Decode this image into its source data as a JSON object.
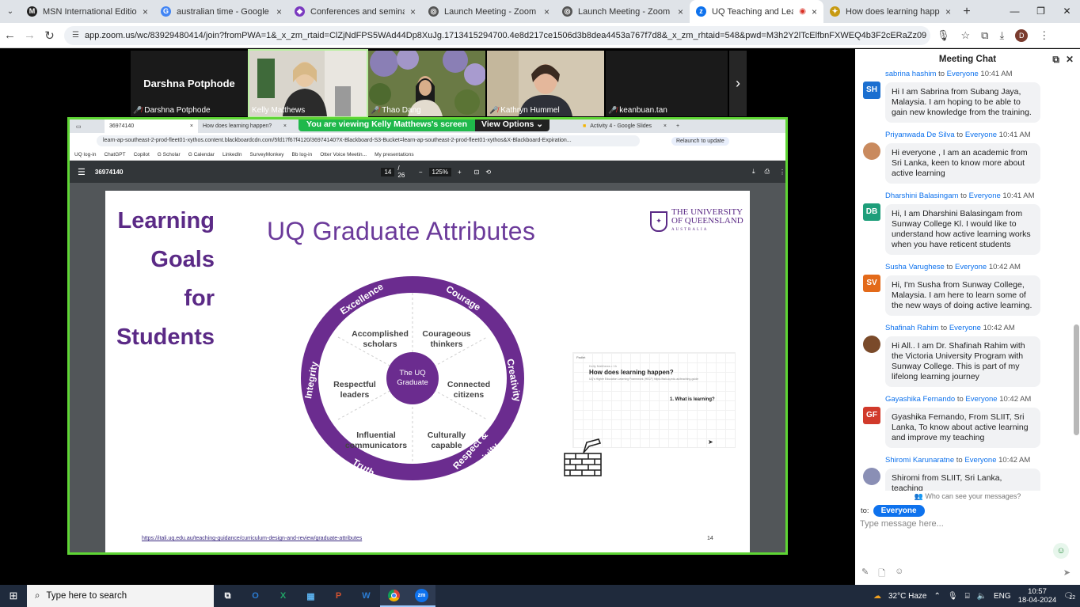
{
  "browser": {
    "tabs": [
      {
        "title": "MSN International Edition - W",
        "icon": "msn-icon",
        "color": "#222"
      },
      {
        "title": "australian time - Google Searc",
        "icon": "google-icon",
        "color": "#4285f4"
      },
      {
        "title": "Conferences and seminars - Gi",
        "icon": "shield-icon",
        "color": "#7b3ac0"
      },
      {
        "title": "Launch Meeting - Zoom",
        "icon": "globe-icon",
        "color": "#555"
      },
      {
        "title": "Launch Meeting - Zoom",
        "icon": "globe-icon",
        "color": "#555"
      },
      {
        "title": "UQ Teaching and Learning",
        "icon": "zoom-icon",
        "color": "#0e72ed",
        "active": true
      },
      {
        "title": "How does learning happen?",
        "icon": "padlet-icon",
        "color": "#c79a12"
      }
    ],
    "url": "app.zoom.us/wc/83929480414/join?fromPWA=1&_x_zm_rtaid=ClZjNdFPS5WAd44Dp8XuJg.1713415294700.4e8d217ce1506d3b8dea4453a767f7d8&_x_zm_rhtaid=548&pwd=M3h2Y2lTcElfbnFXWEQ4b3F2cERaZz09",
    "profile_initial": "D"
  },
  "gallery": {
    "participants": [
      {
        "name": "Darshna Potphode",
        "display": "Darshna Potphode",
        "video": false,
        "muted": true
      },
      {
        "name": "Kelly Matthews",
        "video": true,
        "muted": false,
        "active": true
      },
      {
        "name": "Thao Dang",
        "video": true,
        "muted": true
      },
      {
        "name": "Kathryn Hummel",
        "video": true,
        "muted": true
      },
      {
        "name": "keanbuan.tan",
        "video": false,
        "muted": true
      }
    ]
  },
  "share": {
    "viewing_label": "You are viewing  Kelly Matthews's screen",
    "view_options": "View Options",
    "tabs": [
      {
        "title": "36974140",
        "active": true
      },
      {
        "title": "How does learning happen?"
      },
      {
        "title": "Activity 4 - Google Slides"
      }
    ],
    "url": "learn-ap-southeast-2-prod-fleet01-xythos.content.blackboardcdn.com/5fd17f67f4120/36974140?X-Blackboard-S3-Bucket=learn-ap-southeast-2-prod-fleet01-xythos&X-Blackboard-Expiration...",
    "relaunch": "Relaunch to update",
    "bookmarks": [
      "UQ log-in",
      "ChatGPT",
      "Copilot",
      "G Scholar",
      "G Calendar",
      "LinkedIn",
      "SurveyMonkey",
      "Bb log-in",
      "Otter Voice Meetin...",
      "My presentations"
    ],
    "pdf": {
      "name": "36974140",
      "page": "14",
      "total": "/ 26",
      "zoom": "125%"
    },
    "slide": {
      "learning_goals": [
        "Learning",
        "Goals",
        "for",
        "Students"
      ],
      "title": "UQ Graduate Attributes",
      "logo_line1": "THE UNIVERSITY",
      "logo_line2": "OF QUEENSLAND",
      "logo_line3": "AUSTRALIA",
      "center": [
        "The UQ",
        "Graduate"
      ],
      "segments": [
        [
          "Accomplished",
          "scholars"
        ],
        [
          "Courageous",
          "thinkers"
        ],
        [
          "Connected",
          "citizens"
        ],
        [
          "Culturally",
          "capable"
        ],
        [
          "Influential",
          "communicators"
        ],
        [
          "Respectful",
          "leaders"
        ]
      ],
      "ring_words": [
        "Excellence",
        "Courage",
        "Creativity",
        "Respect &",
        "Inclusivity",
        "Truth",
        "Integrity"
      ],
      "thumb_title": "How does learning happen?",
      "thumb_sub": "UQ's Higher Education Learning Framework (HELF) https://itali.uq.edu.au/teaching-guide",
      "thumb_brand": "Padlet",
      "thumb_author": "Kelly Matthews • 1h",
      "thumb_q": "1. What is learning?",
      "link": "https://itali.uq.edu.au/teaching-guidance/curriculum-design-and-review/graduate-attributes",
      "page_num": "14"
    }
  },
  "chat": {
    "title": "Meeting Chat",
    "messages": [
      {
        "name": "sabrina hashim",
        "to": "to",
        "target": "Everyone",
        "time": "10:41 AM",
        "avatar": "SH",
        "color": "#1b6fd0",
        "text": "Hi I am Sabrina from Subang Jaya, Malaysia. I am hoping to be able to gain new knowledge from the training."
      },
      {
        "name": "Priyanwada De Silva",
        "to": "to",
        "target": "Everyone",
        "time": "10:41 AM",
        "avatar": "",
        "color": "#c98a5e",
        "photo": true,
        "text": "Hi everyone , I am an academic from Sri Lanka, keen to know more about active learning"
      },
      {
        "name": "Dharshini Balasingam",
        "to": "to",
        "target": "Everyone",
        "time": "10:41 AM",
        "avatar": "DB",
        "color": "#1e9e7a",
        "text": "Hi, I am Dharshini Balasingam from Sunway College Kl. I  would like to understand how active learning works when you have reticent students"
      },
      {
        "name": "Susha Varughese",
        "to": "to",
        "target": "Everyone",
        "time": "10:42 AM",
        "avatar": "SV",
        "color": "#e36a1a",
        "text": "Hi, I'm Susha from Sunway College, Malaysia. I am here to learn some of the new ways of doing active learning."
      },
      {
        "name": "Shafinah Rahim",
        "to": "to",
        "target": "Everyone",
        "time": "10:42 AM",
        "avatar": "",
        "color": "#7a4a2a",
        "photo": true,
        "text": "Hi All.. I am Dr. Shafinah Rahim with the Victoria University Program with Sunway College.  This is part of my lifelong learning journey"
      },
      {
        "name": "Gayashika Fernando",
        "to": "to",
        "target": "Everyone",
        "time": "10:42 AM",
        "avatar": "GF",
        "color": "#d13a2b",
        "text": "Gyashika Fernando, From SLIIT, Sri Lanka, To know about active learning and improve my teaching"
      },
      {
        "name": "Shiromi Karunaratne",
        "to": "to",
        "target": "Everyone",
        "time": "10:42 AM",
        "avatar": "",
        "color": "#8a8fb5",
        "photo": true,
        "text": "Shiromi from SLIIT, Sri Lanka, teaching"
      }
    ],
    "who_can_see": "Who can see your messages?",
    "to_label": "to:",
    "recipient": "Everyone",
    "placeholder": "Type message here..."
  },
  "taskbar": {
    "search_placeholder": "Type here to search",
    "apps": [
      "task-view",
      "outlook",
      "excel",
      "calculator",
      "powerpoint",
      "word",
      "chrome",
      "zoom"
    ],
    "app_labels": [
      "⧉",
      "O",
      "X",
      "▦",
      "P",
      "W",
      "",
      "zm"
    ],
    "weather": "32°C  Haze",
    "lang": "ENG",
    "time": "10:57",
    "date": "18-04-2024",
    "notifications": "12"
  }
}
